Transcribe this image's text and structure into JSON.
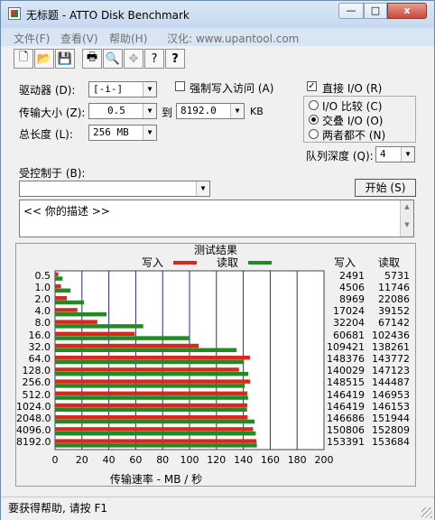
{
  "window": {
    "title": "无标题 - ATTO Disk Benchmark",
    "min_glyph": "—",
    "max_glyph": "□",
    "close_glyph": "x"
  },
  "menu": [
    "文件(F)",
    "查看(V)",
    "帮助(H)",
    "汉化: www.upantool.com"
  ],
  "toolbar": [
    {
      "icon": "new-file-icon",
      "glyph": "🗋"
    },
    {
      "icon": "open-folder-icon",
      "glyph": "📂"
    },
    {
      "icon": "save-disk-icon",
      "glyph": "💾"
    },
    {
      "icon": "printer-icon",
      "glyph": "🖶"
    },
    {
      "icon": "print-preview-icon",
      "glyph": "🔍"
    },
    {
      "icon": "move-arrows-icon",
      "glyph": "✥"
    },
    {
      "icon": "help-question-icon",
      "glyph": "?"
    },
    {
      "icon": "context-help-icon",
      "glyph": "?"
    }
  ],
  "form": {
    "drive_label": "驱动器 (D):",
    "drive_value": "[-i-]",
    "force_write_label": "强制写入访问 (A)",
    "force_write_checked": false,
    "transfer_label": "传输大小 (Z):",
    "transfer_from": "0.5",
    "to_label": "到",
    "transfer_to": "8192.0",
    "kb_label": "KB",
    "total_label": "总长度 (L):",
    "total_value": "256 MB",
    "direct_io_label": "直接 I/O (R)",
    "direct_io_checked": true,
    "radio_options": [
      "I/O 比较 (C)",
      "交叠 I/O (O)",
      "两者都不 (N)"
    ],
    "radio_selected": 1,
    "queue_label": "队列深度 (Q):",
    "queue_value": "4",
    "controlled_label": "受控制于 (B):",
    "controlled_value": "",
    "start_button": "开始 (S)",
    "description": "<<  你的描述  >>"
  },
  "results": {
    "title": "测试结果",
    "legend_write": "写入",
    "legend_read": "读取",
    "col_write": "写入",
    "col_read": "读取",
    "x_label": "传输速率 - MB / 秒"
  },
  "colors": {
    "write": "#d62a1e",
    "read": "#218a21"
  },
  "chart_data": {
    "type": "bar",
    "orientation": "horizontal",
    "categories": [
      "0.5",
      "1.0",
      "2.0",
      "4.0",
      "8.0",
      "16.0",
      "32.0",
      "64.0",
      "128.0",
      "256.0",
      "512.0",
      "1024.0",
      "2048.0",
      "4096.0",
      "8192.0"
    ],
    "series": [
      {
        "name": "写入",
        "values": [
          2491,
          4506,
          8969,
          17024,
          32204,
          60681,
          109421,
          148376,
          140029,
          148515,
          146419,
          146419,
          146686,
          150806,
          153391
        ]
      },
      {
        "name": "读取",
        "values": [
          5731,
          11746,
          22086,
          39152,
          67142,
          102436,
          138261,
          143772,
          147123,
          144487,
          146953,
          146153,
          151944,
          152809,
          153684
        ]
      }
    ],
    "x_ticks": [
      "0",
      "20",
      "40",
      "60",
      "80",
      "100",
      "120",
      "140",
      "160",
      "180",
      "200"
    ],
    "xlim": [
      0,
      200
    ],
    "xlabel": "传输速率 - MB / 秒",
    "grid": true
  },
  "status": "要获得帮助, 请按 F1"
}
